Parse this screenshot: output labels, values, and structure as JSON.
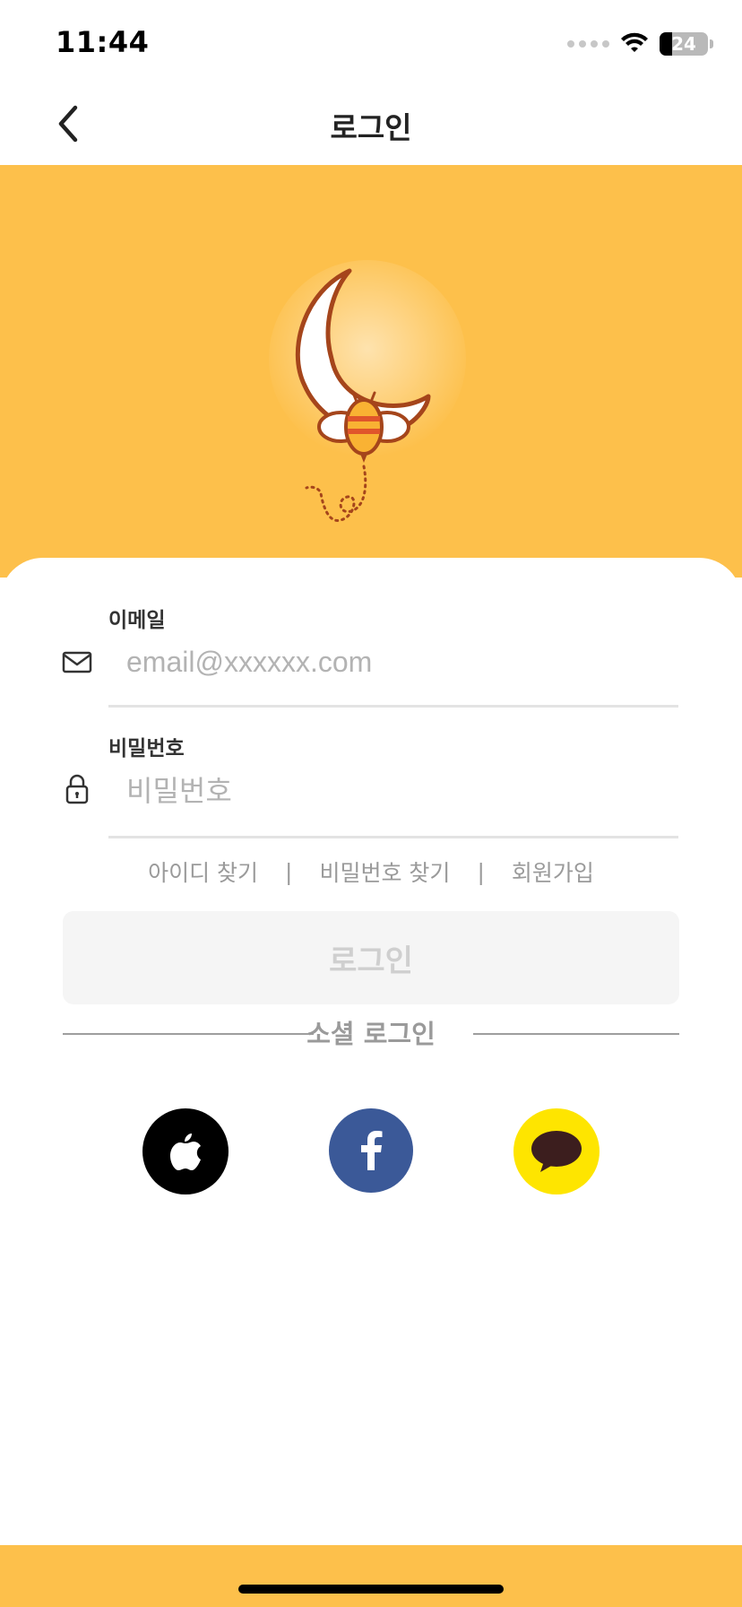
{
  "status_bar": {
    "time": "11:44",
    "battery": "24"
  },
  "header": {
    "title": "로그인"
  },
  "form": {
    "email_label": "이메일",
    "email_placeholder": "email@xxxxxx.com",
    "email_value": "",
    "password_label": "비밀번호",
    "password_placeholder": "비밀번호",
    "password_value": ""
  },
  "links": {
    "find_id": "아이디 찾기",
    "find_password": "비밀번호 찾기",
    "signup": "회원가입",
    "separator": "|"
  },
  "login_button": {
    "label": "로그인"
  },
  "social": {
    "title": "소셜 로그인"
  },
  "colors": {
    "brand_yellow": "#fdc04b",
    "facebook_blue": "#3b5998",
    "kakao_yellow": "#fee500",
    "apple_black": "#000000"
  },
  "icons": [
    "back-chevron-icon",
    "mail-icon",
    "lock-icon",
    "apple-icon",
    "facebook-icon",
    "kakao-chat-icon",
    "moon-bee-logo",
    "wifi-icon"
  ]
}
